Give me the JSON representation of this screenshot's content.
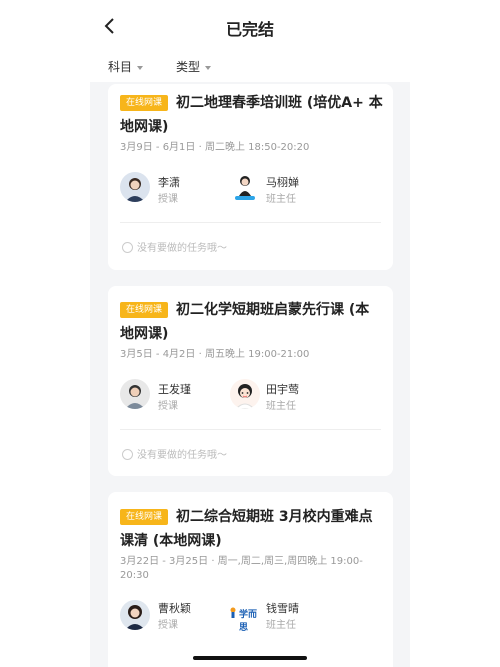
{
  "header": {
    "title": "已完结",
    "back_icon": "chevron-left-icon"
  },
  "filters": [
    {
      "label": "科目"
    },
    {
      "label": "类型"
    }
  ],
  "courses": [
    {
      "tag": "在线网课",
      "title": "初二地理春季培训班 (培优A+ 本地网课)",
      "time": "3月9日 - 6月1日 · 周二晚上 18:50-20:20",
      "teacher": {
        "name": "李潇",
        "role": "授课"
      },
      "head_teacher": {
        "name": "马栩婵",
        "role": "班主任"
      },
      "task_text": "没有要做的任务哦～"
    },
    {
      "tag": "在线网课",
      "title": "初二化学短期班启蒙先行课 (本地网课)",
      "time": "3月5日 - 4月2日 · 周五晚上 19:00-21:00",
      "teacher": {
        "name": "王发瑾",
        "role": "授课"
      },
      "head_teacher": {
        "name": "田宇莺",
        "role": "班主任"
      },
      "task_text": "没有要做的任务哦～"
    },
    {
      "tag": "在线网课",
      "title": "初二综合短期班 3月校内重难点课清 (本地网课)",
      "time": "3月22日 - 3月25日 · 周一,周二,周三,周四晚上 19:00-20:30",
      "teacher": {
        "name": "曹秋颖",
        "role": "授课"
      },
      "head_teacher": {
        "name": "钱雪晴",
        "role": "班主任",
        "logo_text": "学而思"
      }
    }
  ]
}
